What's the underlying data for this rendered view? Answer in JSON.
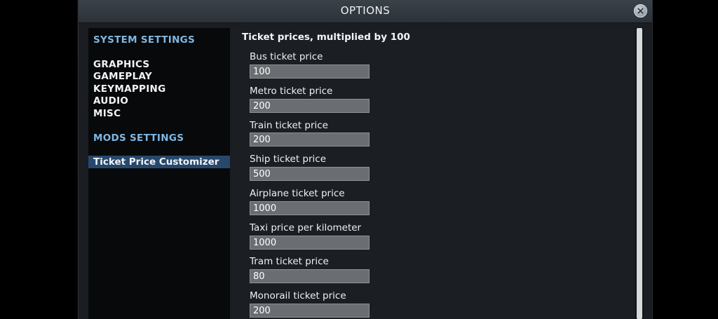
{
  "window": {
    "title": "OPTIONS"
  },
  "sidebar": {
    "system_section": "SYSTEM SETTINGS",
    "system_items": [
      "GRAPHICS",
      "GAMEPLAY",
      "KEYMAPPING",
      "AUDIO",
      "MISC"
    ],
    "mods_section": "MODS SETTINGS",
    "mod_items": [
      "Ticket Price Customizer"
    ]
  },
  "content": {
    "header": "Ticket prices, multiplied by 100",
    "fields": [
      {
        "label": "Bus ticket price",
        "value": "100"
      },
      {
        "label": "Metro ticket price",
        "value": "200"
      },
      {
        "label": "Train ticket price",
        "value": "200"
      },
      {
        "label": "Ship ticket price",
        "value": "500"
      },
      {
        "label": "Airplane ticket price",
        "value": "1000"
      },
      {
        "label": "Taxi price per kilometer",
        "value": "1000"
      },
      {
        "label": "Tram ticket price",
        "value": "80"
      },
      {
        "label": "Monorail ticket price",
        "value": "200"
      }
    ]
  },
  "colors": {
    "section_title": "#7fb7e3",
    "selected_item_bg": "#27486c",
    "input_bg": "#6a6e72"
  },
  "icons": {
    "close": "close-icon"
  }
}
